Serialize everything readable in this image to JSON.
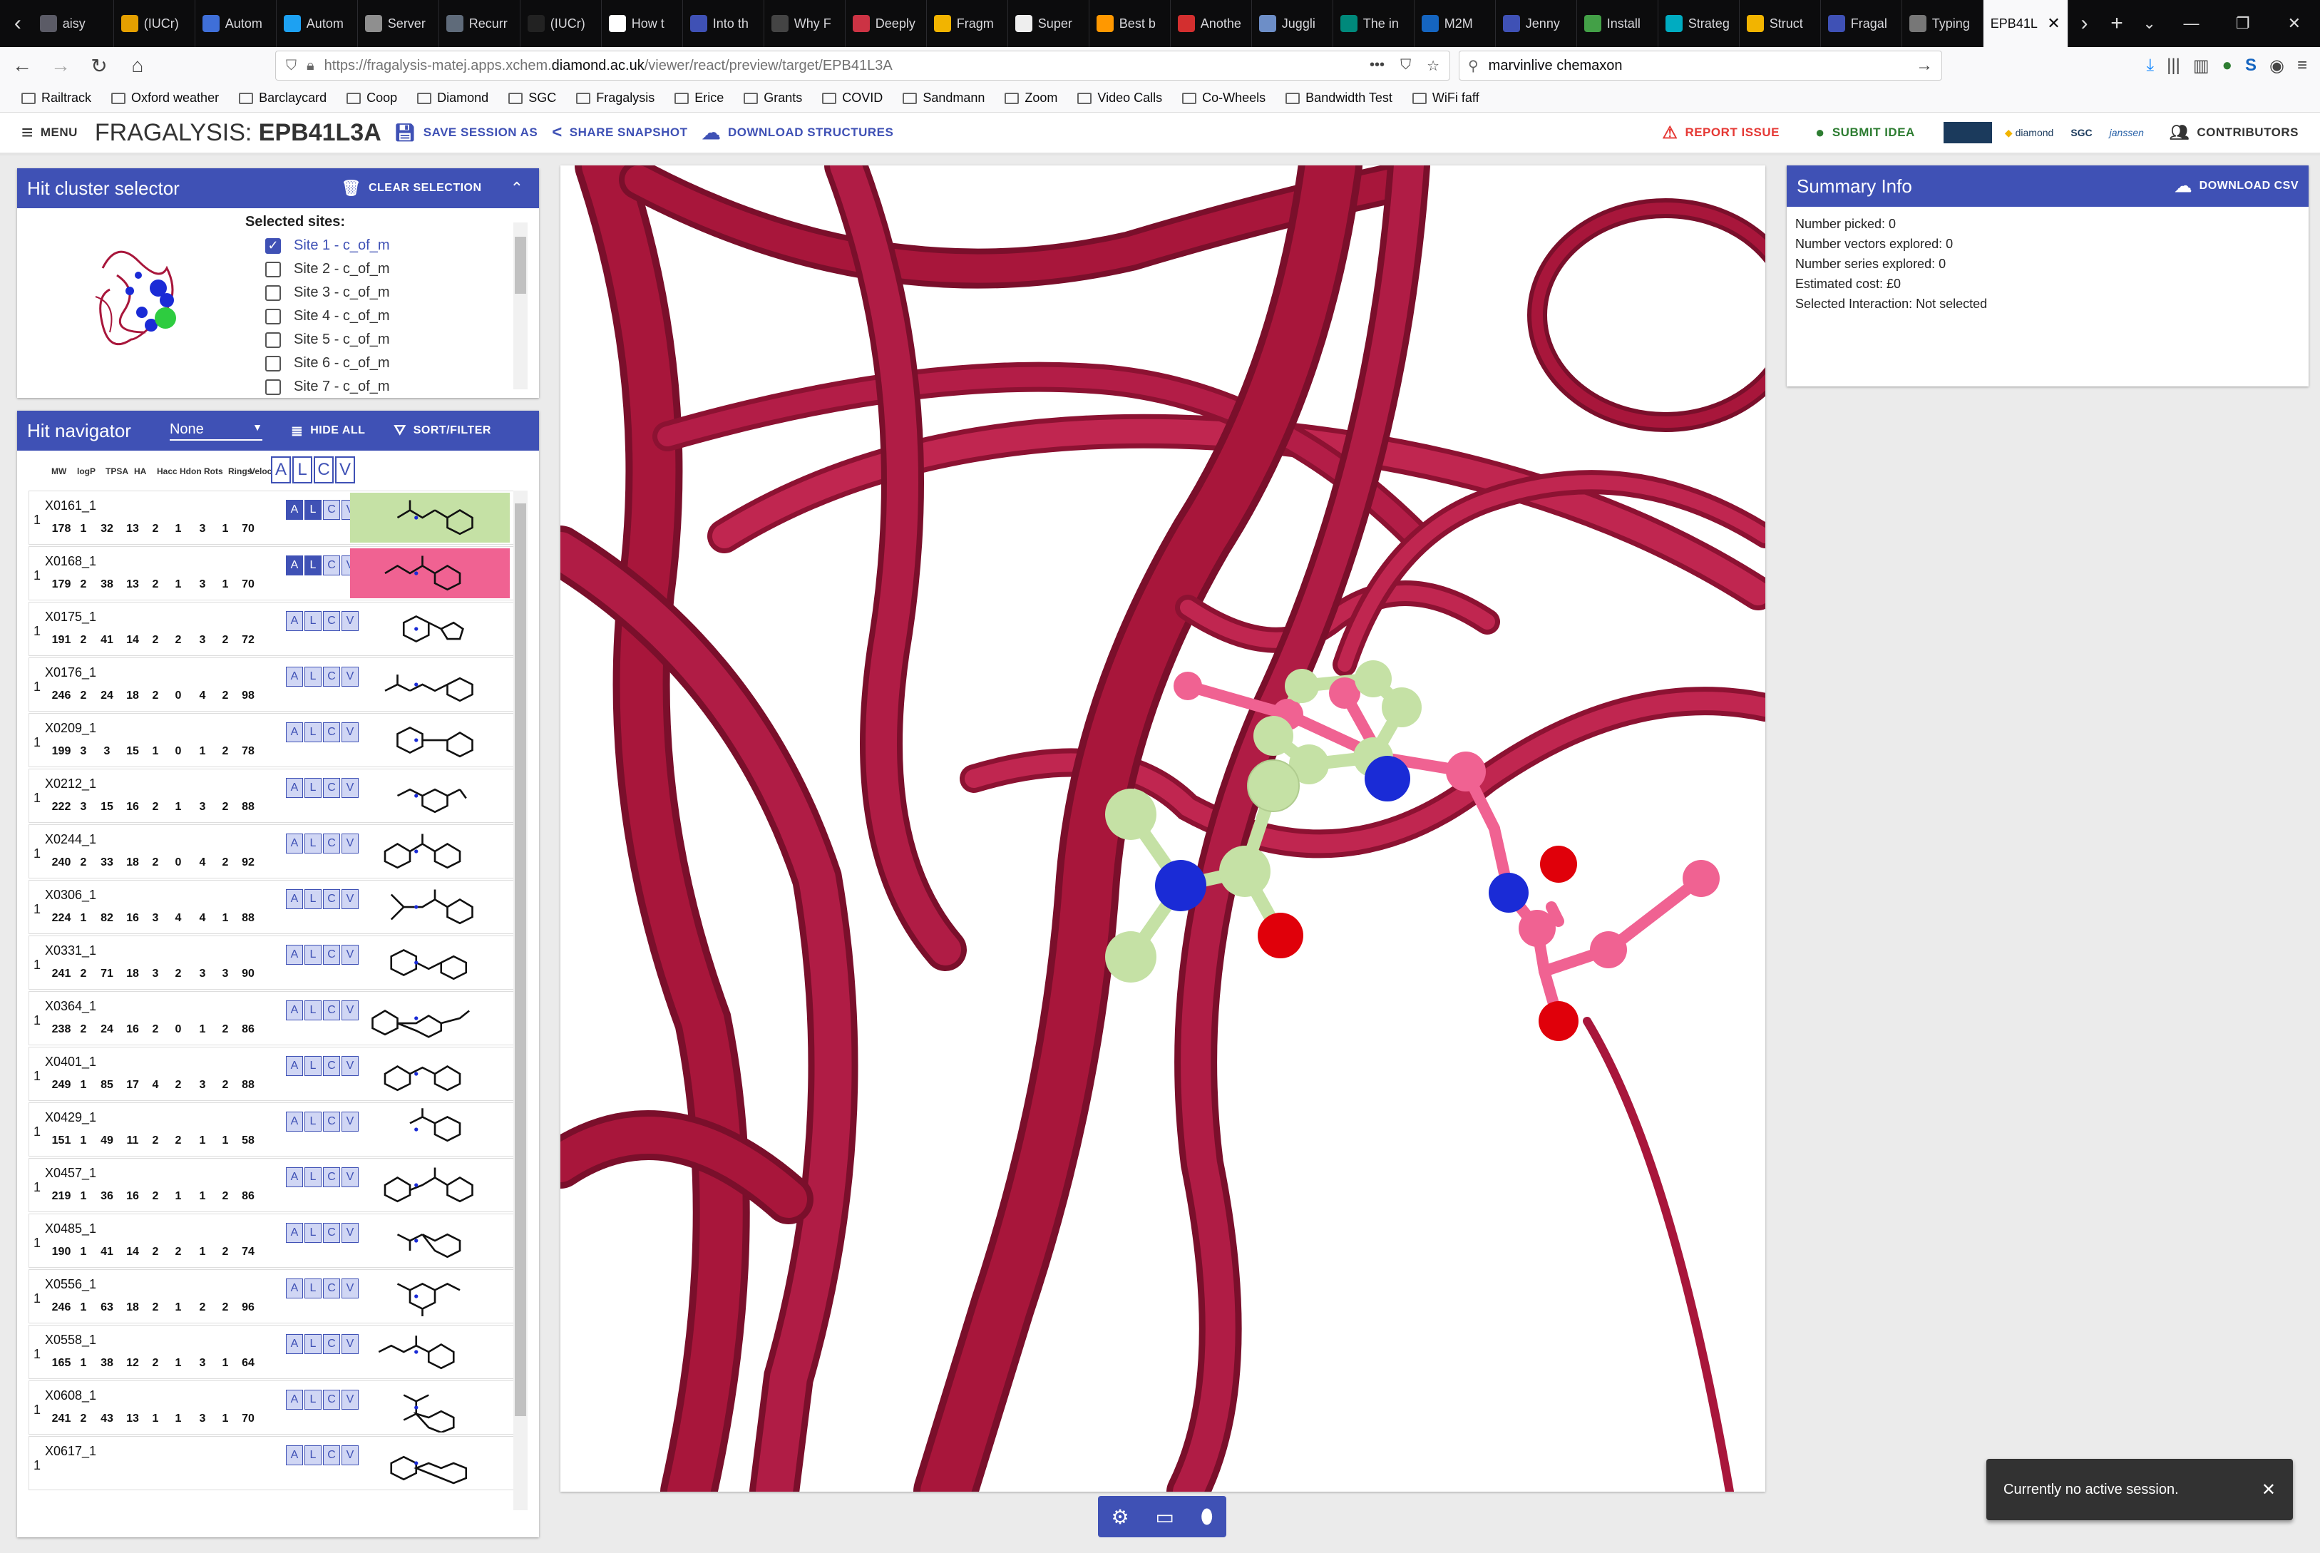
{
  "browser": {
    "tabs": [
      {
        "label": "aisy",
        "color": "#5b5b66"
      },
      {
        "label": "(IUCr)",
        "color": "#e5a000"
      },
      {
        "label": "Autom",
        "color": "#3f6fd8"
      },
      {
        "label": "Autom",
        "color": "#1da1f2"
      },
      {
        "label": "Server",
        "color": "#8f8f8f"
      },
      {
        "label": "Recurr",
        "color": "#5f6b7a"
      },
      {
        "label": "(IUCr)",
        "color": "#222222"
      },
      {
        "label": "How t",
        "color": "#ffffff"
      },
      {
        "label": "Into th",
        "color": "#3f51b5"
      },
      {
        "label": "Why F",
        "color": "#444444"
      },
      {
        "label": "Deeply",
        "color": "#cc3344"
      },
      {
        "label": "Fragm",
        "color": "#f2b400"
      },
      {
        "label": "Super",
        "color": "#eeeeee"
      },
      {
        "label": "Best b",
        "color": "#ff9800"
      },
      {
        "label": "Anothe",
        "color": "#d32f2f"
      },
      {
        "label": "Juggli",
        "color": "#6d8ec7"
      },
      {
        "label": "The in",
        "color": "#00897b"
      },
      {
        "label": "M2M",
        "color": "#1565c0"
      },
      {
        "label": "Jenny",
        "color": "#3f51b5"
      },
      {
        "label": "Install",
        "color": "#43a047"
      },
      {
        "label": "Strateg",
        "color": "#00acc1"
      },
      {
        "label": "Struct",
        "color": "#f2b400"
      },
      {
        "label": "Fragal",
        "color": "#3f51b5"
      },
      {
        "label": "Typing",
        "color": "#777777"
      }
    ],
    "active_tab": "EPB41L",
    "url_prefix": "https://fragalysis-matej.apps.xchem.",
    "url_host": "diamond.ac.uk",
    "url_path": "/viewer/react/preview/target/EPB41L3A",
    "search_value": "marvinlive chemaxon",
    "bookmarks": [
      "Railtrack",
      "Oxford weather",
      "Barclaycard",
      "Coop",
      "Diamond",
      "SGC",
      "Fragalysis",
      "Erice",
      "Grants",
      "COVID",
      "Sandmann",
      "Zoom",
      "Video Calls",
      "Co-Wheels",
      "Bandwidth Test",
      "WiFi faff"
    ]
  },
  "header": {
    "menu_label": "MENU",
    "app_name": "FRAGALYSIS:",
    "target": "EPB41L3A",
    "save_session": "SAVE SESSION AS",
    "share_snapshot": "SHARE SNAPSHOT",
    "download_structures": "DOWNLOAD STRUCTURES",
    "report_issue": "REPORT ISSUE",
    "submit_idea": "SUBMIT IDEA",
    "contributors": "CONTRIBUTORS",
    "logos": [
      "diamond",
      "SGC",
      "janssen"
    ],
    "colors": {
      "primary": "#3f51b5",
      "report": "#e53935",
      "idea": "#2e7d32"
    }
  },
  "cluster_selector": {
    "title": "Hit cluster selector",
    "clear_label": "CLEAR SELECTION",
    "selected_sites_label": "Selected sites:",
    "sites": [
      {
        "label": "Site 1 - c_of_m",
        "checked": true
      },
      {
        "label": "Site 2 - c_of_m",
        "checked": false
      },
      {
        "label": "Site 3 - c_of_m",
        "checked": false
      },
      {
        "label": "Site 4 - c_of_m",
        "checked": false
      },
      {
        "label": "Site 5 - c_of_m",
        "checked": false
      },
      {
        "label": "Site 6 - c_of_m",
        "checked": false
      },
      {
        "label": "Site 7 - c_of_m",
        "checked": false
      }
    ]
  },
  "hit_navigator": {
    "title": "Hit navigator",
    "filter_value": "None",
    "hide_all": "HIDE ALL",
    "sort_filter": "SORT/FILTER",
    "columns": [
      "MW",
      "logP",
      "TPSA",
      "HA",
      "Hacc",
      "Hdon",
      "Rots",
      "Rings",
      "Velocity"
    ],
    "header_toggles": [
      "A",
      "L",
      "C",
      "V"
    ],
    "toggle_labels": [
      "A",
      "L",
      "C",
      "V"
    ],
    "hits": [
      {
        "name": "X0161_1",
        "count": "1",
        "props": [
          "178",
          "1",
          "32",
          "13",
          "2",
          "1",
          "3",
          "1",
          "70"
        ],
        "on": [
          "A",
          "L"
        ],
        "bg": "#c5e1a5"
      },
      {
        "name": "X0168_1",
        "count": "1",
        "props": [
          "179",
          "2",
          "38",
          "13",
          "2",
          "1",
          "3",
          "1",
          "70"
        ],
        "on": [
          "A",
          "L"
        ],
        "bg": "#f06292"
      },
      {
        "name": "X0175_1",
        "count": "1",
        "props": [
          "191",
          "2",
          "41",
          "14",
          "2",
          "2",
          "3",
          "2",
          "72"
        ],
        "on": [],
        "bg": ""
      },
      {
        "name": "X0176_1",
        "count": "1",
        "props": [
          "246",
          "2",
          "24",
          "18",
          "2",
          "0",
          "4",
          "2",
          "98"
        ],
        "on": [],
        "bg": ""
      },
      {
        "name": "X0209_1",
        "count": "1",
        "props": [
          "199",
          "3",
          "3",
          "15",
          "1",
          "0",
          "1",
          "2",
          "78"
        ],
        "on": [],
        "bg": ""
      },
      {
        "name": "X0212_1",
        "count": "1",
        "props": [
          "222",
          "3",
          "15",
          "16",
          "2",
          "1",
          "3",
          "2",
          "88"
        ],
        "on": [],
        "bg": ""
      },
      {
        "name": "X0244_1",
        "count": "1",
        "props": [
          "240",
          "2",
          "33",
          "18",
          "2",
          "0",
          "4",
          "2",
          "92"
        ],
        "on": [],
        "bg": ""
      },
      {
        "name": "X0306_1",
        "count": "1",
        "props": [
          "224",
          "1",
          "82",
          "16",
          "3",
          "4",
          "4",
          "1",
          "88"
        ],
        "on": [],
        "bg": ""
      },
      {
        "name": "X0331_1",
        "count": "1",
        "props": [
          "241",
          "2",
          "71",
          "18",
          "3",
          "2",
          "3",
          "3",
          "90"
        ],
        "on": [],
        "bg": ""
      },
      {
        "name": "X0364_1",
        "count": "1",
        "props": [
          "238",
          "2",
          "24",
          "16",
          "2",
          "0",
          "1",
          "2",
          "86"
        ],
        "on": [],
        "bg": ""
      },
      {
        "name": "X0401_1",
        "count": "1",
        "props": [
          "249",
          "1",
          "85",
          "17",
          "4",
          "2",
          "3",
          "2",
          "88"
        ],
        "on": [],
        "bg": ""
      },
      {
        "name": "X0429_1",
        "count": "1",
        "props": [
          "151",
          "1",
          "49",
          "11",
          "2",
          "2",
          "1",
          "1",
          "58"
        ],
        "on": [],
        "bg": ""
      },
      {
        "name": "X0457_1",
        "count": "1",
        "props": [
          "219",
          "1",
          "36",
          "16",
          "2",
          "1",
          "1",
          "2",
          "86"
        ],
        "on": [],
        "bg": ""
      },
      {
        "name": "X0485_1",
        "count": "1",
        "props": [
          "190",
          "1",
          "41",
          "14",
          "2",
          "2",
          "1",
          "2",
          "74"
        ],
        "on": [],
        "bg": ""
      },
      {
        "name": "X0556_1",
        "count": "1",
        "props": [
          "246",
          "1",
          "63",
          "18",
          "2",
          "1",
          "2",
          "2",
          "96"
        ],
        "on": [],
        "bg": ""
      },
      {
        "name": "X0558_1",
        "count": "1",
        "props": [
          "165",
          "1",
          "38",
          "12",
          "2",
          "1",
          "3",
          "1",
          "64"
        ],
        "on": [],
        "bg": ""
      },
      {
        "name": "X0608_1",
        "count": "1",
        "props": [
          "241",
          "2",
          "43",
          "13",
          "1",
          "1",
          "3",
          "1",
          "70"
        ],
        "on": [],
        "bg": ""
      },
      {
        "name": "X0617_1",
        "count": "1",
        "props": [
          "",
          "",
          "",
          "",
          "",
          "",
          "",
          "",
          ""
        ],
        "on": [],
        "bg": ""
      }
    ]
  },
  "summary": {
    "title": "Summary Info",
    "download_csv": "DOWNLOAD CSV",
    "lines": [
      "Number picked: 0",
      "Number vectors explored: 0",
      "Number series explored: 0",
      "Estimated cost: £0",
      "Selected Interaction: Not selected"
    ]
  },
  "viewer": {
    "ribbon_color": "#a8163b",
    "ligand_a_color": "#c5e1a5",
    "ligand_b_color": "#f06292"
  },
  "snackbar": {
    "message": "Currently no active session.",
    "close": "✕"
  }
}
